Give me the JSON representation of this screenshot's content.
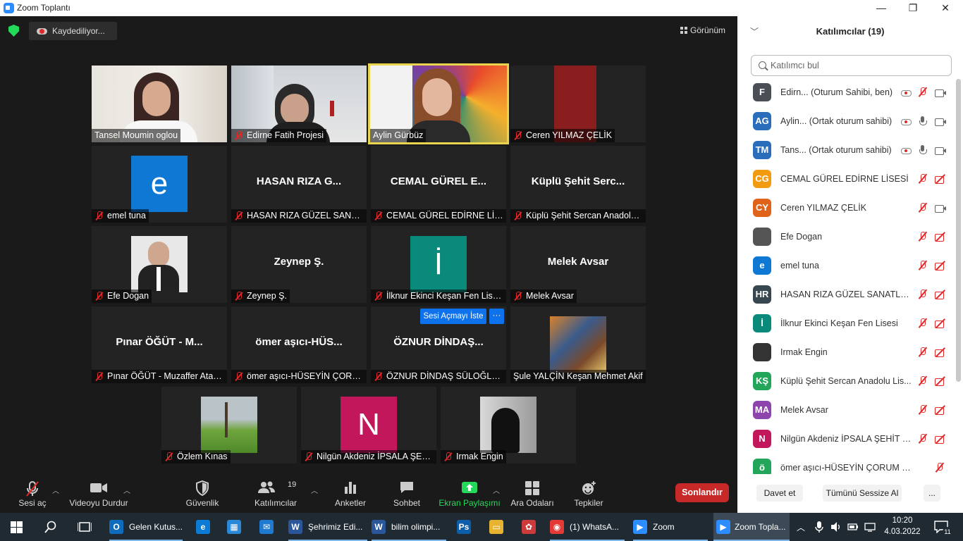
{
  "window": {
    "title": "Zoom Toplantı",
    "minimize": "—",
    "maximize": "❐",
    "close": "✕"
  },
  "topbar": {
    "recording_label": "Kaydediliyor...",
    "view_label": "Görünüm"
  },
  "tiles": [
    {
      "name": "Tansel Moumin oglou",
      "muted": false
    },
    {
      "name": "Edirne Fatih Projesi",
      "muted": true
    },
    {
      "name": "Aylin Gürbüz",
      "muted": false,
      "speaking": true
    },
    {
      "name": "Ceren YILMAZ ÇELİK",
      "muted": true
    },
    {
      "name": "emel tuna",
      "muted": true,
      "avatar_letter": "e",
      "avatar_color": "#0e78d4"
    },
    {
      "name": "HASAN RIZA GÜZEL SANATLAR...",
      "big": "HASAN RIZA G...",
      "muted": true
    },
    {
      "name": "CEMAL GÜREL EDİRNE LİSESİ",
      "big": "CEMAL GÜREL E...",
      "muted": true
    },
    {
      "name": "Küplü Şehit Sercan Anadolu Lisesi",
      "big": "Küplü  Şehit  Serc...",
      "muted": true
    },
    {
      "name": "Efe Dogan",
      "muted": true
    },
    {
      "name": "Zeynep Ş.",
      "big": "Zeynep Ş.",
      "muted": true
    },
    {
      "name": "İlknur Ekinci Keşan Fen Lisesi",
      "muted": true,
      "avatar_letter": "İ",
      "avatar_color": "#0a8a7a"
    },
    {
      "name": "Melek Avsar",
      "big": "Melek Avsar",
      "muted": true
    },
    {
      "name": "Pınar ÖĞÜT - Muzaffer Atasoy",
      "big": "Pınar ÖĞÜT  -  M...",
      "muted": true
    },
    {
      "name": "ömer aşıcı-HÜSEYİN ÇORUM MTAL",
      "big": "ömer  aşıcı-HÜS...",
      "muted": true
    },
    {
      "name": "ÖZNUR DİNDAŞ SÜLOĞLU MYO",
      "big": "ÖZNUR  DİNDAŞ...",
      "muted": true
    },
    {
      "name": "Şule YALÇİN Keşan Mehmet Akif",
      "muted": false
    },
    {
      "name": "Özlem Kınas",
      "muted": true
    },
    {
      "name": "Nilgün Akdeniz İPSALA ŞEHİT",
      "muted": true,
      "avatar_letter": "N",
      "avatar_color": "#c2185b"
    },
    {
      "name": "Irmak Engin",
      "muted": true
    }
  ],
  "ask_unmute": {
    "label": "Sesi Açmayı İste",
    "more": "···"
  },
  "toolbar": {
    "unmute": "Sesi aç",
    "video": "Videoyu Durdur",
    "security": "Güvenlik",
    "participants": "Katılımcılar",
    "participants_count": "19",
    "polls": "Anketler",
    "chat": "Sohbet",
    "share": "Ekran Paylaşımı",
    "breakout": "Ara Odaları",
    "reactions": "Tepkiler",
    "end": "Sonlandır",
    "share_color": "#23d959",
    "end_color": "#c72828"
  },
  "panel": {
    "title": "Katılımcılar (19)",
    "search_placeholder": "Katılımcı bul",
    "participants": [
      {
        "initials": "F",
        "color": "#4a4f55",
        "name": "Edirn...",
        "role": "(Oturum Sahibi, ben)",
        "rec": true,
        "mic": "muted",
        "cam": "on"
      },
      {
        "initials": "AG",
        "color": "#2a6ebb",
        "name": "Aylin...",
        "role": "(Ortak oturum sahibi)",
        "rec": true,
        "mic": "on",
        "cam": "on"
      },
      {
        "initials": "TM",
        "color": "#2a6ebb",
        "name": "Tans...",
        "role": "(Ortak oturum sahibi)",
        "rec": true,
        "mic": "on",
        "cam": "on"
      },
      {
        "initials": "CG",
        "color": "#f29b11",
        "name": "CEMAL GÜREL EDİRNE LİSESİ",
        "role": "",
        "rec": false,
        "mic": "muted",
        "cam": "off"
      },
      {
        "initials": "CY",
        "color": "#e0631c",
        "name": "Ceren YILMAZ ÇELİK",
        "role": "",
        "rec": false,
        "mic": "muted",
        "cam": "on"
      },
      {
        "initials": "",
        "color": "#555555",
        "name": "Efe Dogan",
        "role": "",
        "rec": false,
        "mic": "muted",
        "cam": "off"
      },
      {
        "initials": "e",
        "color": "#0e78d4",
        "name": "emel tuna",
        "role": "",
        "rec": false,
        "mic": "muted",
        "cam": "off"
      },
      {
        "initials": "HR",
        "color": "#37474f",
        "name": "HASAN RIZA GÜZEL SANATLAR...",
        "role": "",
        "rec": false,
        "mic": "muted",
        "cam": "off"
      },
      {
        "initials": "İ",
        "color": "#0a8a7a",
        "name": "İlknur Ekinci Keşan Fen Lisesi",
        "role": "",
        "rec": false,
        "mic": "muted",
        "cam": "off"
      },
      {
        "initials": "",
        "color": "#333333",
        "name": "Irmak Engin",
        "role": "",
        "rec": false,
        "mic": "muted",
        "cam": "off"
      },
      {
        "initials": "KŞ",
        "color": "#23a55a",
        "name": "Küplü Şehit Sercan Anadolu Lis...",
        "role": "",
        "rec": false,
        "mic": "muted",
        "cam": "off"
      },
      {
        "initials": "MA",
        "color": "#8e44ad",
        "name": "Melek Avsar",
        "role": "",
        "rec": false,
        "mic": "muted",
        "cam": "off"
      },
      {
        "initials": "N",
        "color": "#c2185b",
        "name": "Nilgün Akdeniz İPSALA ŞEHİT E...",
        "role": "",
        "rec": false,
        "mic": "muted",
        "cam": "off"
      },
      {
        "initials": "ö",
        "color": "#23a55a",
        "name": "ömer aşıcı-HÜSEYİN ÇORUM MTAL...",
        "role": "",
        "rec": false,
        "mic": "muted",
        "cam": "none"
      }
    ],
    "invite": "Davet et",
    "mute_all": "Tümünü Sessize Al",
    "more": "..."
  },
  "taskbar": {
    "apps": [
      {
        "label": "Gelen Kutus...",
        "color": "#0f6cbd",
        "glyph": "O"
      },
      {
        "label": "",
        "color": "#0c7bd6",
        "glyph": "e"
      },
      {
        "label": "",
        "color": "#2b88d8",
        "glyph": "▦"
      },
      {
        "label": "",
        "color": "#1f7bd1",
        "glyph": "✉"
      },
      {
        "label": "Şehrimiz Edi...",
        "color": "#2b579a",
        "glyph": "W"
      },
      {
        "label": "bilim olimpi...",
        "color": "#2b579a",
        "glyph": "W"
      },
      {
        "label": "",
        "color": "#0d5da8",
        "glyph": "Ps"
      },
      {
        "label": "",
        "color": "#e8b330",
        "glyph": "▭"
      },
      {
        "label": "",
        "color": "#cc3a3a",
        "glyph": "✿"
      },
      {
        "label": "(1) WhatsA...",
        "color": "#e53935",
        "glyph": "◉"
      },
      {
        "label": "Zoom",
        "color": "#2d8cff",
        "glyph": "▶"
      },
      {
        "label": "Zoom Topla...",
        "color": "#2d8cff",
        "glyph": "▶"
      }
    ],
    "time": "10:20",
    "date": "4.03.2022",
    "notif_count": "11"
  }
}
